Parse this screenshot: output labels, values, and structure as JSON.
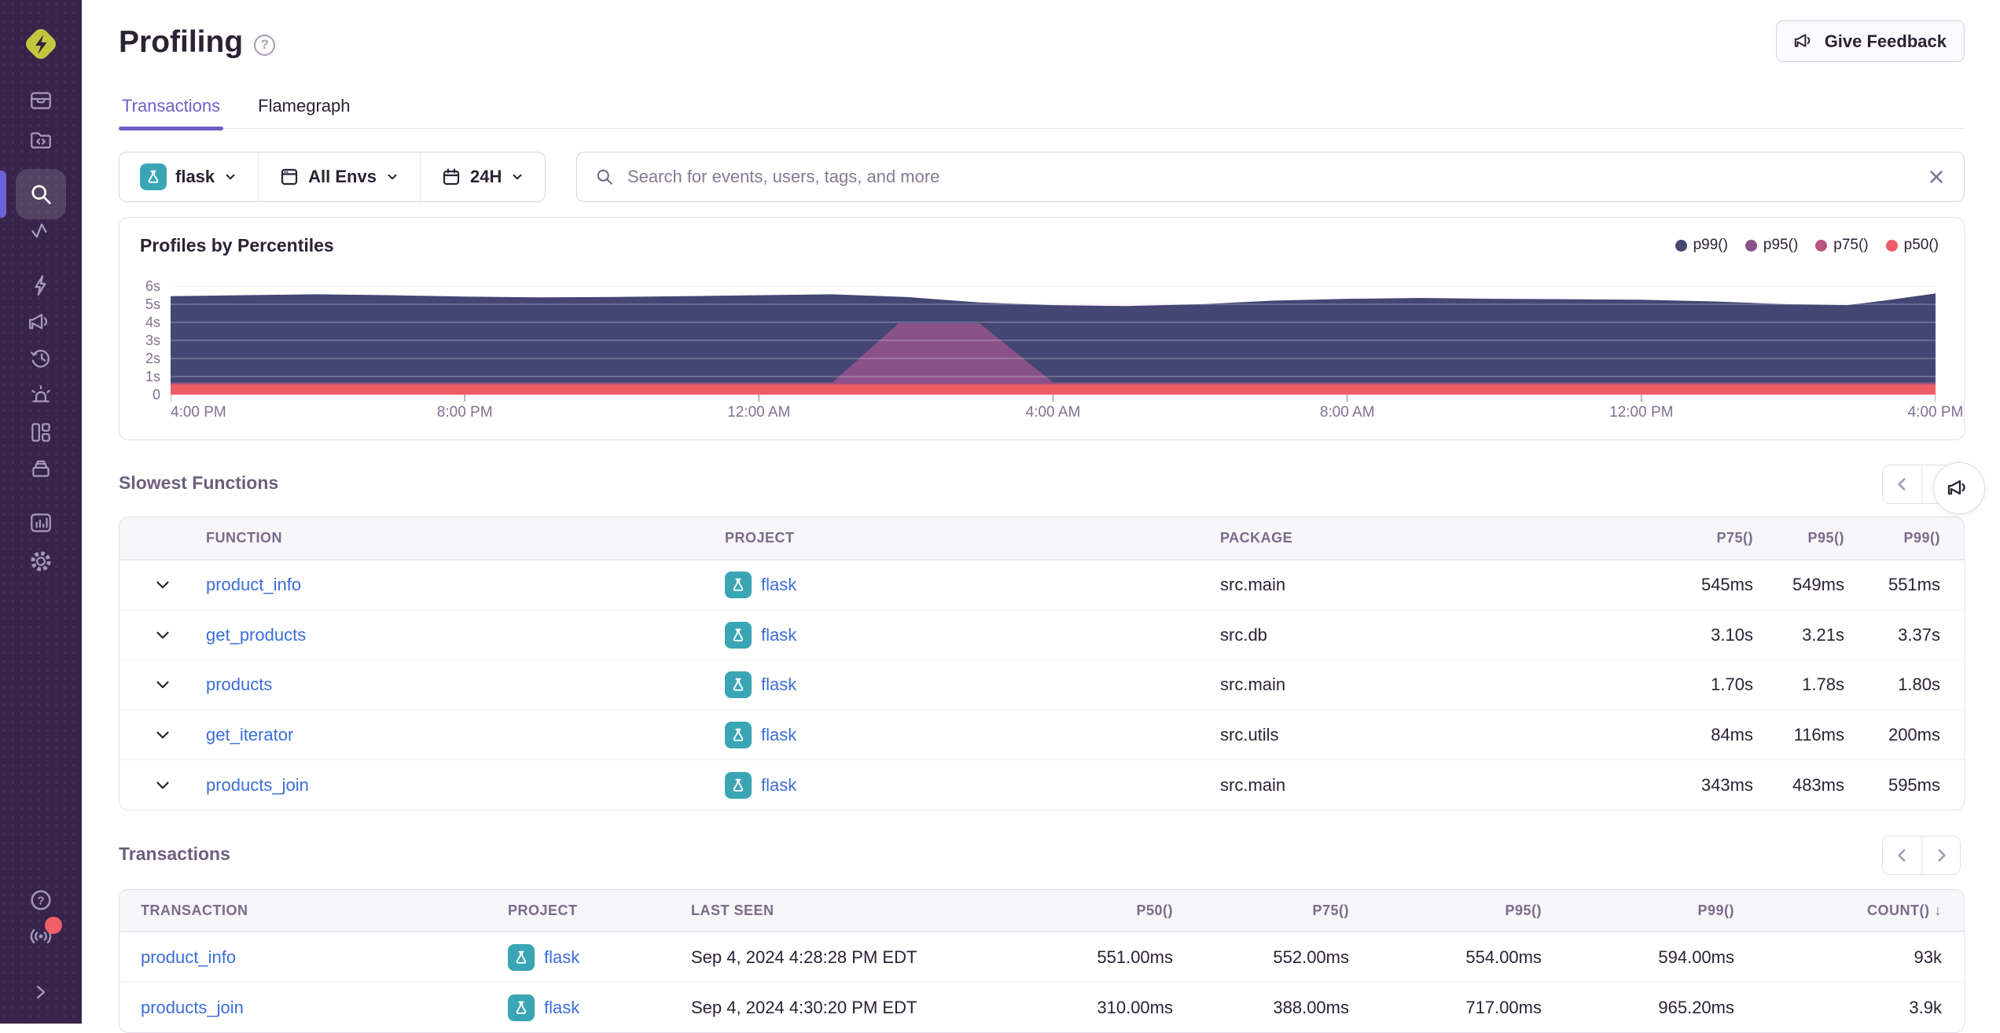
{
  "colors": {
    "accent": "#6c5fc7",
    "link": "#3b6dd8",
    "sidebar_bg": "#38244a",
    "flask_chip_bg": "#3aa5b4",
    "badge_red": "#ef5f68",
    "logo_yellow": "#c2c73f"
  },
  "sidebar": {
    "logo": "sentry-logo",
    "icons": [
      "issues",
      "projects",
      "search",
      "traces",
      "lightning",
      "megaphone",
      "replays",
      "alerts",
      "dashboards",
      "releases",
      "stats",
      "settings"
    ],
    "active_icon": "search",
    "bottom_icons": [
      "help",
      "broadcast",
      "expand"
    ],
    "broadcast_has_badge": true
  },
  "header": {
    "title": "Profiling",
    "feedback_button": "Give Feedback"
  },
  "tabs": {
    "items": [
      {
        "label": "Transactions",
        "active": true
      },
      {
        "label": "Flamegraph",
        "active": false
      }
    ]
  },
  "filters": {
    "project": "flask",
    "environment": "All Envs",
    "date_range": "24H",
    "search_placeholder": "Search for events, users, tags, and more"
  },
  "profiles_chart": {
    "title": "Profiles by Percentiles",
    "chart_data": {
      "type": "area",
      "title": "Profiles by Percentiles",
      "x_axis": {
        "ticks": [
          "4:00 PM",
          "8:00 PM",
          "12:00 AM",
          "4:00 AM",
          "8:00 AM",
          "12:00 PM",
          "4:00 PM"
        ],
        "range_hours": [
          0,
          24
        ]
      },
      "y_axis": {
        "ticks": [
          "6s",
          "5s",
          "4s",
          "3s",
          "2s",
          "1s",
          "0"
        ],
        "unit": "seconds",
        "range": [
          0,
          6
        ]
      },
      "legend": [
        "p99()",
        "p95()",
        "p75()",
        "p50()"
      ],
      "legend_position": "top-right",
      "grid": "horizontal",
      "series": [
        {
          "name": "p99()",
          "color": "#444674",
          "points": [
            [
              0,
              5.45
            ],
            [
              1,
              5.5
            ],
            [
              2,
              5.55
            ],
            [
              3,
              5.5
            ],
            [
              4,
              5.42
            ],
            [
              5,
              5.38
            ],
            [
              6,
              5.4
            ],
            [
              7,
              5.45
            ],
            [
              8,
              5.5
            ],
            [
              9,
              5.55
            ],
            [
              10,
              5.4
            ],
            [
              11,
              5.1
            ],
            [
              12,
              4.95
            ],
            [
              13,
              4.9
            ],
            [
              14,
              5.0
            ],
            [
              15,
              5.2
            ],
            [
              16,
              5.3
            ],
            [
              17,
              5.35
            ],
            [
              18,
              5.3
            ],
            [
              19,
              5.28
            ],
            [
              20,
              5.25
            ],
            [
              21,
              5.15
            ],
            [
              22,
              5.0
            ],
            [
              22.8,
              4.95
            ],
            [
              23.3,
              5.2
            ],
            [
              24,
              5.6
            ]
          ]
        },
        {
          "name": "p95()",
          "color": "#895289",
          "points": [
            [
              0,
              0.68
            ],
            [
              9,
              0.68
            ],
            [
              9.9,
              3.95
            ],
            [
              11,
              3.95
            ],
            [
              12,
              0.68
            ],
            [
              24,
              0.68
            ]
          ]
        },
        {
          "name": "p75()",
          "color": "#bc5480",
          "points": [
            [
              0,
              0.62
            ],
            [
              24,
              0.62
            ]
          ]
        },
        {
          "name": "p50()",
          "color": "#ee5d66",
          "points": [
            [
              0,
              0.55
            ],
            [
              24,
              0.55
            ]
          ]
        }
      ]
    }
  },
  "slowest_functions": {
    "title": "Slowest Functions",
    "columns": [
      "FUNCTION",
      "PROJECT",
      "PACKAGE",
      "P75()",
      "P95()",
      "P99()"
    ],
    "rows": [
      {
        "function": "product_info",
        "project": "flask",
        "package": "src.main",
        "p75": "545ms",
        "p95": "549ms",
        "p99": "551ms"
      },
      {
        "function": "get_products",
        "project": "flask",
        "package": "src.db",
        "p75": "3.10s",
        "p95": "3.21s",
        "p99": "3.37s"
      },
      {
        "function": "products",
        "project": "flask",
        "package": "src.main",
        "p75": "1.70s",
        "p95": "1.78s",
        "p99": "1.80s"
      },
      {
        "function": "get_iterator",
        "project": "flask",
        "package": "src.utils",
        "p75": "84ms",
        "p95": "116ms",
        "p99": "200ms"
      },
      {
        "function": "products_join",
        "project": "flask",
        "package": "src.main",
        "p75": "343ms",
        "p95": "483ms",
        "p99": "595ms"
      }
    ]
  },
  "transactions": {
    "title": "Transactions",
    "columns": [
      "TRANSACTION",
      "PROJECT",
      "LAST SEEN",
      "P50()",
      "P75()",
      "P95()",
      "P99()",
      "COUNT()"
    ],
    "sort_column": "COUNT()",
    "sort_arrow": "↓",
    "rows": [
      {
        "transaction": "product_info",
        "project": "flask",
        "last_seen": "Sep 4, 2024 4:28:28 PM EDT",
        "p50": "551.00ms",
        "p75": "552.00ms",
        "p95": "554.00ms",
        "p99": "594.00ms",
        "count": "93k"
      },
      {
        "transaction": "products_join",
        "project": "flask",
        "last_seen": "Sep 4, 2024 4:30:20 PM EDT",
        "p50": "310.00ms",
        "p75": "388.00ms",
        "p95": "717.00ms",
        "p99": "965.20ms",
        "count": "3.9k"
      }
    ]
  }
}
